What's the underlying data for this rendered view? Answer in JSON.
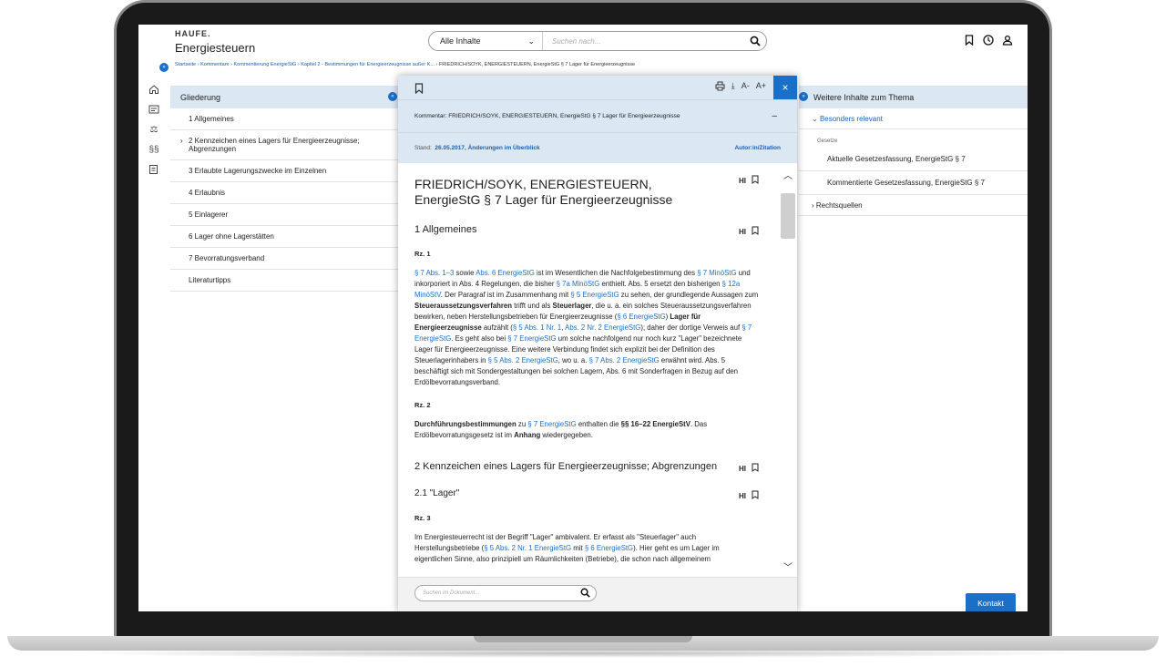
{
  "header": {
    "logo": "HAUFE.",
    "product": "Energiesteuern",
    "scope": "Alle Inhalte",
    "search_placeholder": "Suchen nach..."
  },
  "breadcrumb": {
    "items": [
      "Startseite",
      "Kommentare",
      "Kommentierung EnergieStG",
      "Kapitel 2 - Bestimmungen für Energieerzeugnisse außer K..."
    ],
    "current": "FRIEDRICH/SOYK, ENERGIESTEUERN, EnergieStG § 7 Lager für Energieerzeugnisse"
  },
  "outline": {
    "title": "Gliederung",
    "items": [
      {
        "label": "1 Allgemeines",
        "chevron": ""
      },
      {
        "label": "2 Kennzeichen eines Lagers für Energieerzeugnisse; Abgrenzungen",
        "chevron": "›"
      },
      {
        "label": "3 Erlaubte Lagerungszwecke im Einzelnen",
        "chevron": ""
      },
      {
        "label": "4 Erlaubnis",
        "chevron": ""
      },
      {
        "label": "5 Einlagerer",
        "chevron": ""
      },
      {
        "label": "6 Lager ohne Lagerstätten",
        "chevron": ""
      },
      {
        "label": "7 Bevorratungsverband",
        "chevron": ""
      },
      {
        "label": "Literaturtipps",
        "chevron": ""
      }
    ]
  },
  "related": {
    "title": "Weitere Inhalte zum Thema",
    "section": "Besonders relevant",
    "group": "Gesetze",
    "links": [
      "Aktuelle Gesetzesfassung, EnergieStG § 7",
      "Kommentierte Gesetzesfassung, EnergieStG § 7"
    ],
    "sources": "Rechtsquellen"
  },
  "document": {
    "bar_title": "Kommentar: FRIEDRICH/SOYK, ENERGIESTEUERN, EnergieStG § 7 Lager für Energieerzeugnisse",
    "stand_label": "Stand:",
    "stand_value": "26.05.2017, Änderungen im Überblick",
    "author_link": "Autor:in/Zitation",
    "title": "FRIEDRICH/SOYK, ENERGIESTEUERN, EnergieStG § 7 Lager für Energieerzeugnisse",
    "hi": "HI",
    "s1": "1 Allgemeines",
    "rz1": "Rz. 1",
    "rz2": "Rz. 2",
    "s2": "2 Kennzeichen eines Lagers für Energieerzeugnisse; Abgrenzungen",
    "s21": "2.1 \"Lager\"",
    "rz3": "Rz. 3",
    "search_placeholder": "Suchen im Dokument..."
  },
  "kontakt": "Kontakt"
}
